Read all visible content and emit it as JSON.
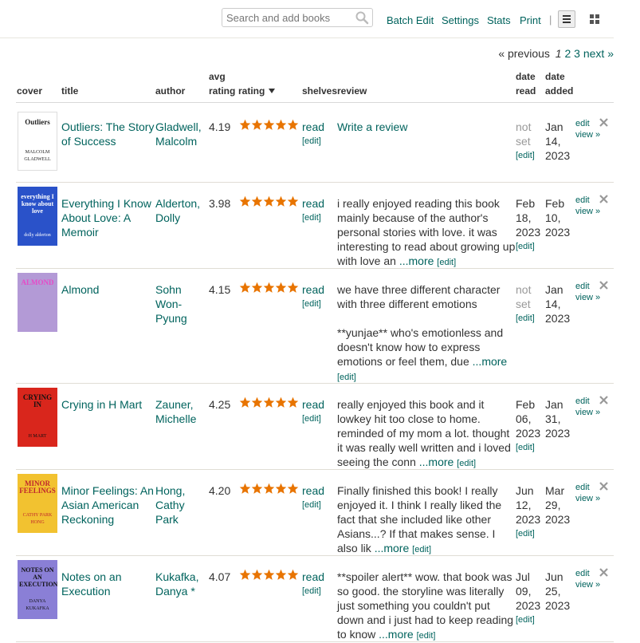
{
  "search": {
    "placeholder": "Search and add books"
  },
  "toolbar": {
    "batch_edit": "Batch Edit",
    "settings": "Settings",
    "stats": "Stats",
    "print": "Print",
    "separator": "|"
  },
  "pager": {
    "previous": "« previous",
    "current": "1",
    "p2": "2",
    "p3": "3",
    "next": "next »"
  },
  "columns": {
    "cover": "cover",
    "title": "title",
    "author": "author",
    "avg_rating_1": "avg",
    "avg_rating_2": "rating",
    "rating": "rating",
    "shelves": "shelves",
    "review": "review",
    "date_read_1": "date",
    "date_read_2": "read",
    "date_added_1": "date",
    "date_added_2": "added"
  },
  "labels": {
    "edit": "edit",
    "view": "view »",
    "edit_bracket": "[edit]",
    "more": "...more",
    "write_review": "Write a review",
    "star": "★"
  },
  "books": [
    {
      "title": "Outliers: The Story of Success",
      "author": "Gladwell, Malcolm",
      "avg": "4.19",
      "rating": 5,
      "shelf": "read",
      "review": "",
      "review_extra": "",
      "date_read": "not set",
      "date_added": "Jan 14, 2023",
      "cover": {
        "text1": "Outliers",
        "text2": "MALCOLM GLADWELL",
        "bg": "#ffffff",
        "fg": "#222222"
      }
    },
    {
      "title": "Everything I Know About Love: A Memoir",
      "author": "Alderton, Dolly",
      "avg": "3.98",
      "rating": 5,
      "shelf": "read",
      "review": "i really enjoyed reading this book mainly because of the author's personal stories with love. it was interesting to read about growing up with love an",
      "review_extra": "",
      "date_read": "Feb 18, 2023",
      "date_added": "Feb 10, 2023",
      "cover": {
        "text1": "everything I know about love",
        "text2": "dolly alderton",
        "bg": "#2a52c9",
        "fg": "#ffffff"
      }
    },
    {
      "title": "Almond",
      "author": "Sohn Won-Pyung",
      "avg": "4.15",
      "rating": 5,
      "shelf": "read",
      "review": "we have three different character with three different emotions",
      "review_extra": "**yunjae** who's emotionless and doesn't know how to express emotions or feel them, due",
      "date_read": "not set",
      "date_added": "Jan 14, 2023",
      "cover": {
        "text1": "ALMOND",
        "text2": "",
        "bg": "#b39ad6",
        "fg": "#e64ac7"
      }
    },
    {
      "title": "Crying in H Mart",
      "author": "Zauner, Michelle",
      "avg": "4.25",
      "rating": 5,
      "shelf": "read",
      "review": "really enjoyed this book and it lowkey hit too close to home. reminded of my mom a lot. thought it was really well written and i loved seeing the conn",
      "review_extra": "",
      "date_read": "Feb 06, 2023",
      "date_added": "Jan 31, 2023",
      "cover": {
        "text1": "CRYING IN",
        "text2": "H MART",
        "bg": "#d9261c",
        "fg": "#111111"
      }
    },
    {
      "title": "Minor Feelings: An Asian American Reckoning",
      "author": "Hong, Cathy Park",
      "avg": "4.20",
      "rating": 5,
      "shelf": "read",
      "review": "Finally finished this book! I really enjoyed it. I think I really liked the fact that she included like other Asians...? If that makes sense. I also lik",
      "review_extra": "",
      "date_read": "Jun 12, 2023",
      "date_added": "Mar 29, 2023",
      "cover": {
        "text1": "MINOR FEELINGS",
        "text2": "CATHY PARK HONG",
        "bg": "#f2c230",
        "fg": "#c0262d"
      }
    },
    {
      "title": "Notes on an Execution",
      "author": "Kukafka, Danya *",
      "avg": "4.07",
      "rating": 5,
      "shelf": "read",
      "review": "**spoiler alert** wow. that book was so good. the storyline was literally just something you couldn't put down and i just had to keep reading to know",
      "review_extra": "",
      "date_read": "Jul 09, 2023",
      "date_added": "Jun 25, 2023",
      "cover": {
        "text1": "NOTES ON AN EXECUTION",
        "text2": "DANYA KUKAFKA",
        "bg": "#8a7fd6",
        "fg": "#111111"
      }
    }
  ],
  "colors": {
    "link": "#00635d",
    "star": "#e87400"
  }
}
